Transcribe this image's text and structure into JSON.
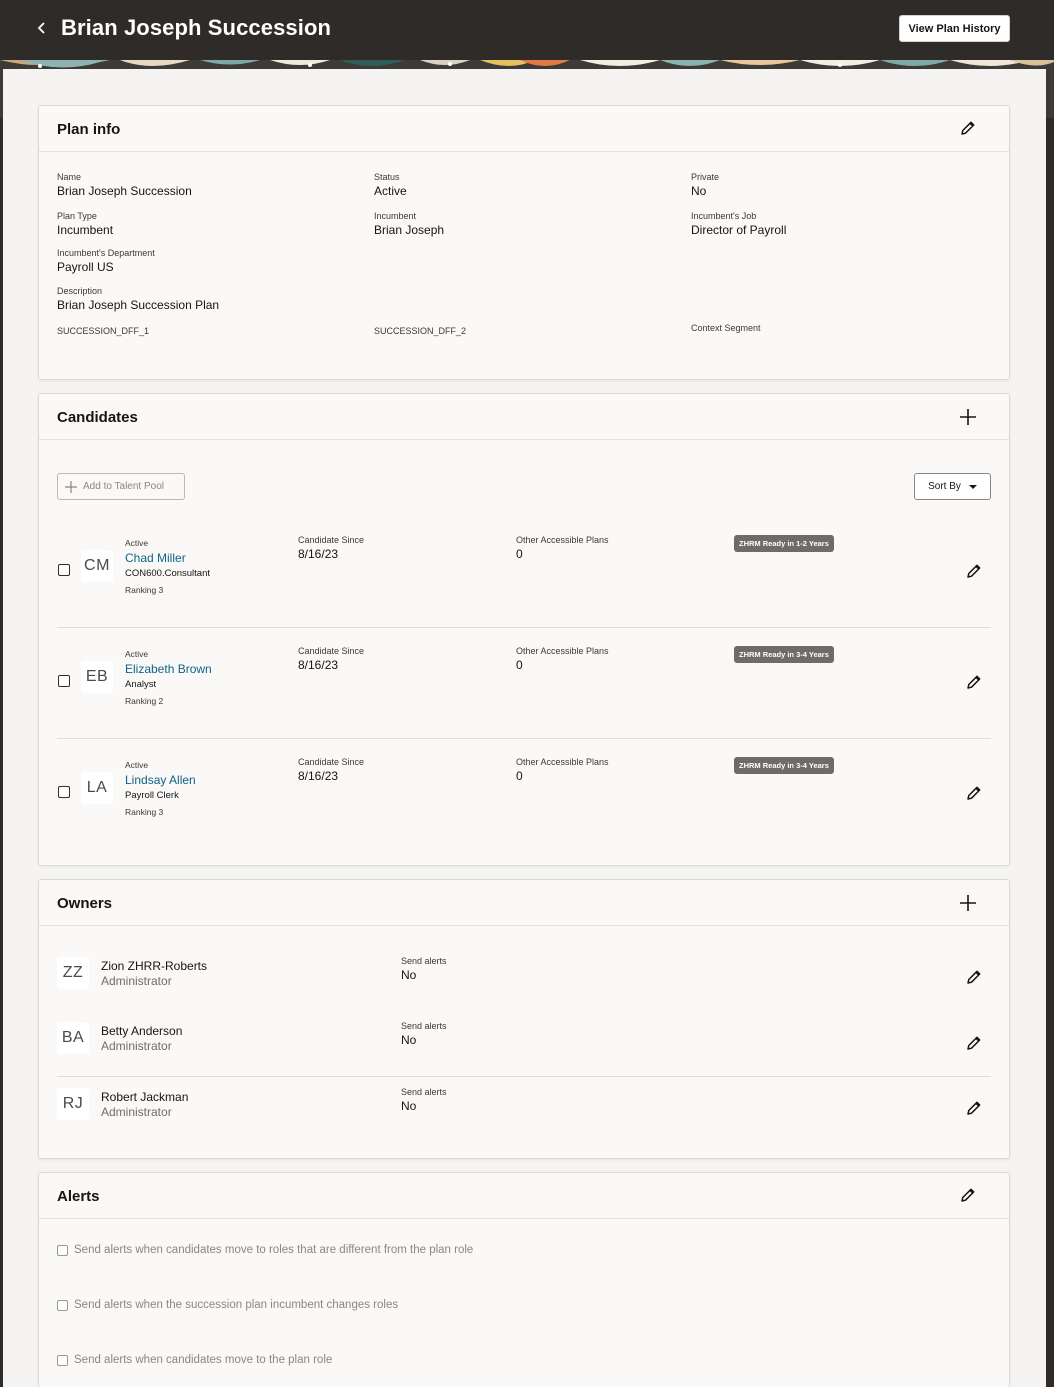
{
  "header": {
    "title": "Brian Joseph Succession",
    "view_history_label": "View Plan History"
  },
  "plan_info": {
    "title": "Plan info",
    "fields": {
      "name": {
        "label": "Name",
        "value": "Brian Joseph Succession"
      },
      "status": {
        "label": "Status",
        "value": "Active"
      },
      "private": {
        "label": "Private",
        "value": "No"
      },
      "plan_type": {
        "label": "Plan Type",
        "value": "Incumbent"
      },
      "incumbent": {
        "label": "Incumbent",
        "value": "Brian Joseph"
      },
      "incumbent_job": {
        "label": "Incumbent's Job",
        "value": "Director of Payroll"
      },
      "incumbent_dept": {
        "label": "Incumbent's Department",
        "value": "Payroll US"
      },
      "description": {
        "label": "Description",
        "value": "Brian Joseph Succession Plan"
      },
      "dff1": {
        "label": "SUCCESSION_DFF_1"
      },
      "dff2": {
        "label": "SUCCESSION_DFF_2"
      },
      "context": {
        "label": "Context Segment"
      }
    }
  },
  "candidates": {
    "title": "Candidates",
    "add_to_pool_label": "Add to Talent Pool",
    "sort_label": "Sort By",
    "since_label": "Candidate Since",
    "plans_label": "Other Accessible Plans",
    "items": [
      {
        "initials": "CM",
        "status": "Active",
        "name": "Chad Miller",
        "job": "CON600.Consultant",
        "ranking": "Ranking 3",
        "since": "8/16/23",
        "plans": "0",
        "readiness": "ZHRM Ready in 1-2 Years"
      },
      {
        "initials": "EB",
        "status": "Active",
        "name": "Elizabeth Brown",
        "job": "Analyst",
        "ranking": "Ranking 2",
        "since": "8/16/23",
        "plans": "0",
        "readiness": "ZHRM Ready in 3-4 Years"
      },
      {
        "initials": "LA",
        "status": "Active",
        "name": "Lindsay Allen",
        "job": "Payroll Clerk",
        "ranking": "Ranking 3",
        "since": "8/16/23",
        "plans": "0",
        "readiness": "ZHRM Ready in 3-4 Years"
      }
    ]
  },
  "owners": {
    "title": "Owners",
    "alerts_label": "Send alerts",
    "items": [
      {
        "initials": "ZZ",
        "name": "Zion ZHRR-Roberts",
        "role": "Administrator",
        "alerts": "No"
      },
      {
        "initials": "BA",
        "name": "Betty Anderson",
        "role": "Administrator",
        "alerts": "No"
      },
      {
        "initials": "RJ",
        "name": "Robert Jackman",
        "role": "Administrator",
        "alerts": "No"
      }
    ]
  },
  "alerts": {
    "title": "Alerts",
    "options": [
      "Send alerts when candidates move to roles that are different from the plan role",
      "Send alerts when the succession plan incumbent changes roles",
      "Send alerts when candidates move to the plan role"
    ]
  }
}
